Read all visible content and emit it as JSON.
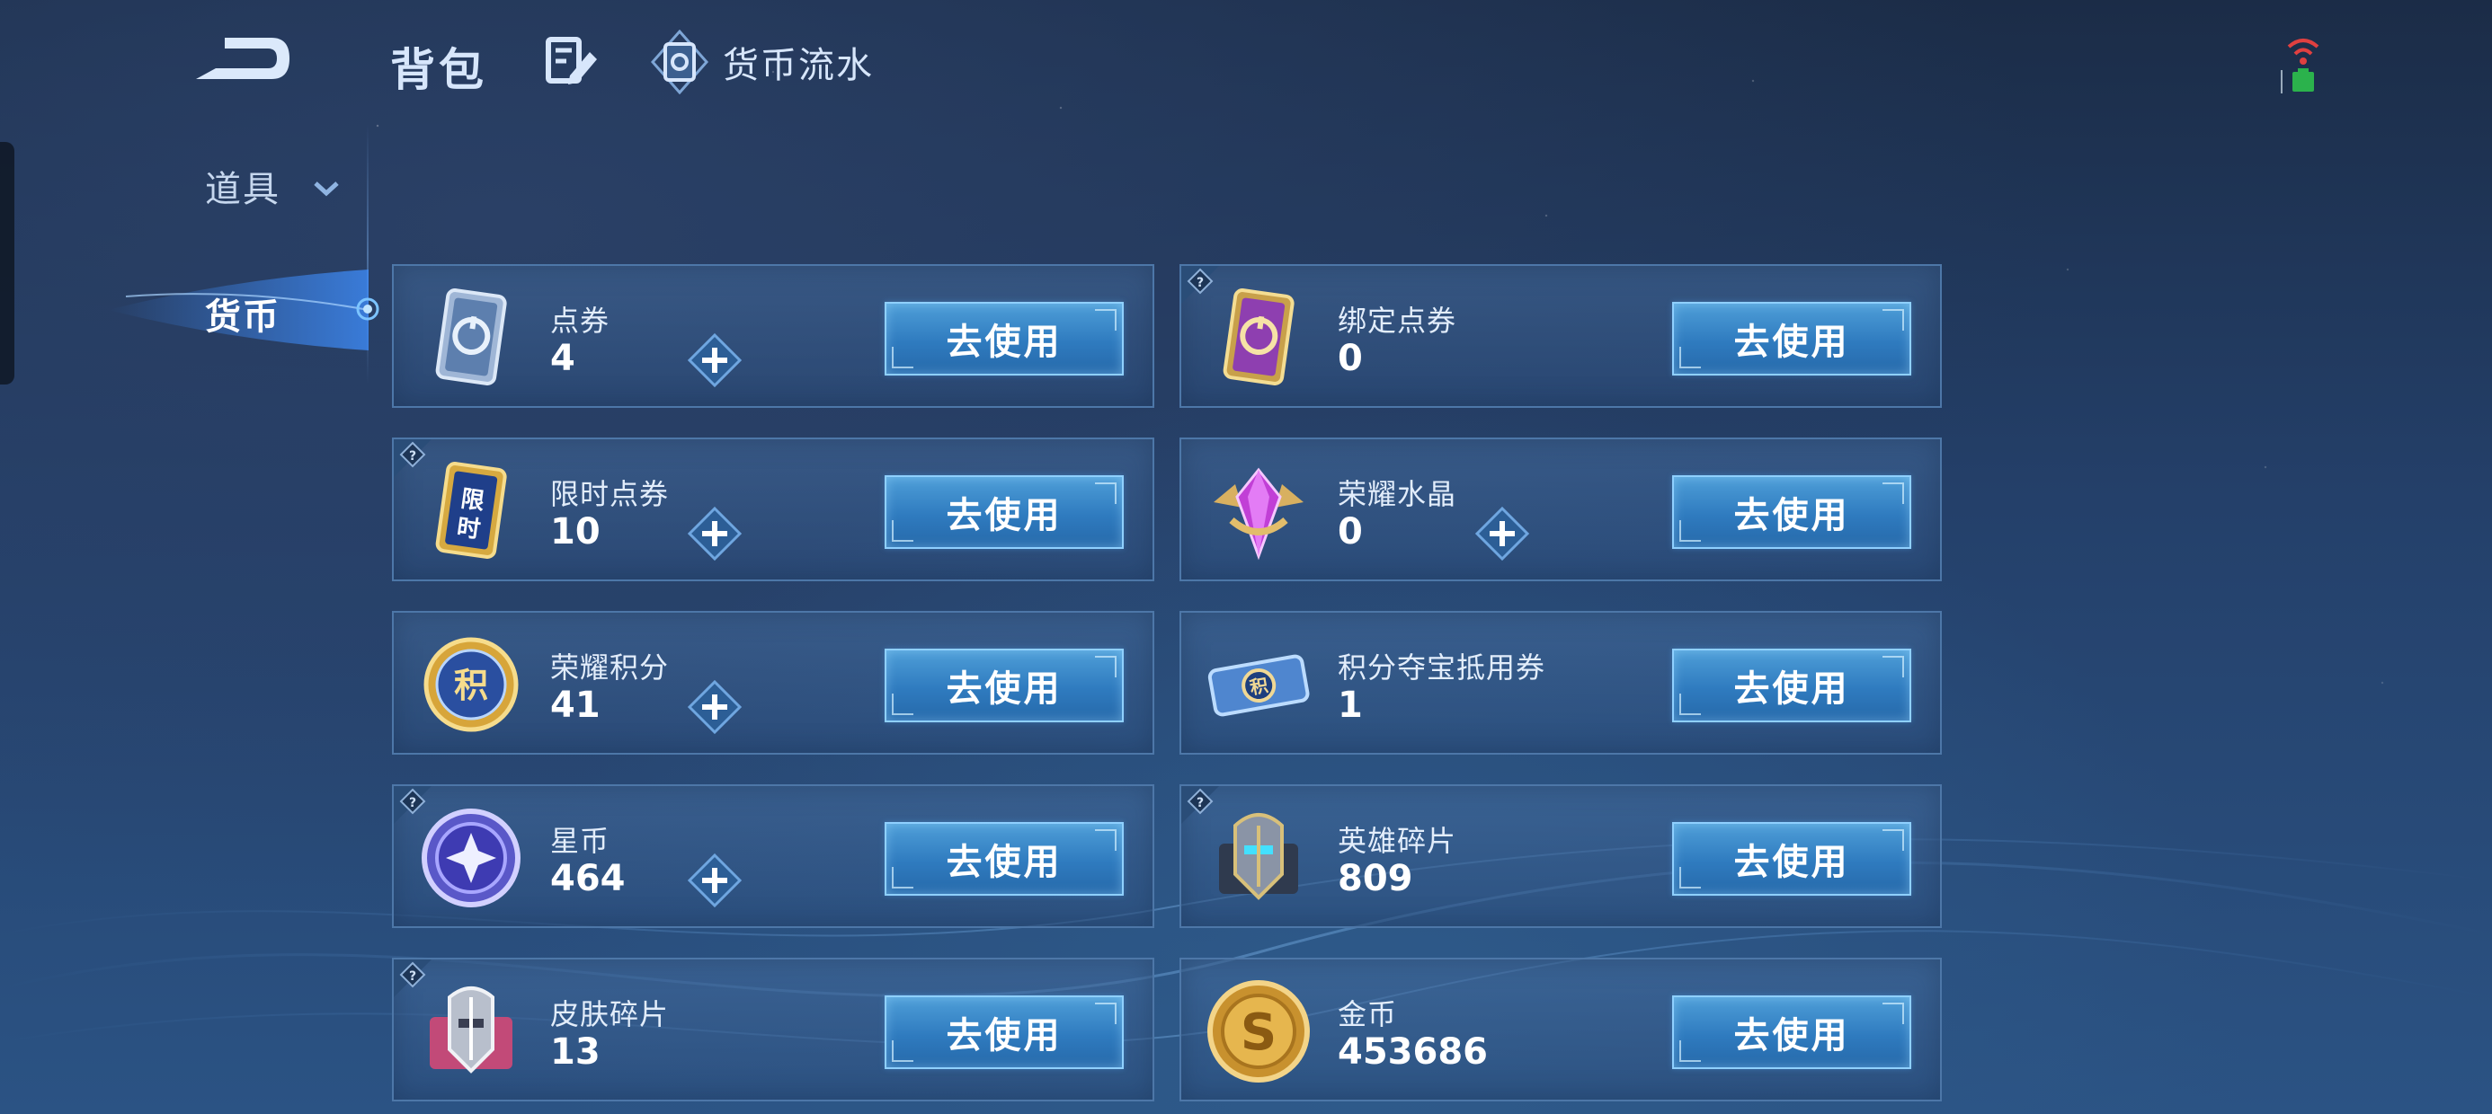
{
  "header": {
    "title": "背包",
    "flow_label": "货币流水"
  },
  "sidebar": {
    "items": [
      {
        "label": "道具",
        "expandable": true
      },
      {
        "label": "货币",
        "selected": true
      }
    ]
  },
  "currencies": [
    {
      "name": "点券",
      "value": "4",
      "icon": "coupon-card-icon",
      "has_plus": true,
      "has_help": false,
      "button": "去使用"
    },
    {
      "name": "绑定点券",
      "value": "0",
      "icon": "bound-coupon-card-icon",
      "has_plus": false,
      "has_help": true,
      "button": "去使用"
    },
    {
      "name": "限时点券",
      "value": "10",
      "icon": "limited-coupon-card-icon",
      "has_plus": true,
      "has_help": true,
      "button": "去使用"
    },
    {
      "name": "荣耀水晶",
      "value": "0",
      "icon": "glory-crystal-icon",
      "has_plus": true,
      "has_help": false,
      "button": "去使用"
    },
    {
      "name": "荣耀积分",
      "value": "41",
      "icon": "glory-points-medal-icon",
      "has_plus": true,
      "has_help": false,
      "button": "去使用"
    },
    {
      "name": "积分夺宝抵用券",
      "value": "1",
      "icon": "points-treasure-ticket-icon",
      "has_plus": false,
      "has_help": false,
      "button": "去使用"
    },
    {
      "name": "星币",
      "value": "464",
      "icon": "star-coin-icon",
      "has_plus": true,
      "has_help": true,
      "button": "去使用"
    },
    {
      "name": "英雄碎片",
      "value": "809",
      "icon": "hero-shard-icon",
      "has_plus": false,
      "has_help": true,
      "button": "去使用"
    },
    {
      "name": "皮肤碎片",
      "value": "13",
      "icon": "skin-shard-icon",
      "has_plus": false,
      "has_help": true,
      "button": "去使用"
    },
    {
      "name": "金币",
      "value": "453686",
      "icon": "gold-coin-icon",
      "has_plus": false,
      "has_help": false,
      "button": "去使用"
    }
  ],
  "colors": {
    "background": "#24406a",
    "card_border": "#4d77a8",
    "button_blue": "#2f7bbf",
    "button_border": "#8fd0ff",
    "text_light": "#d7e6fb"
  }
}
